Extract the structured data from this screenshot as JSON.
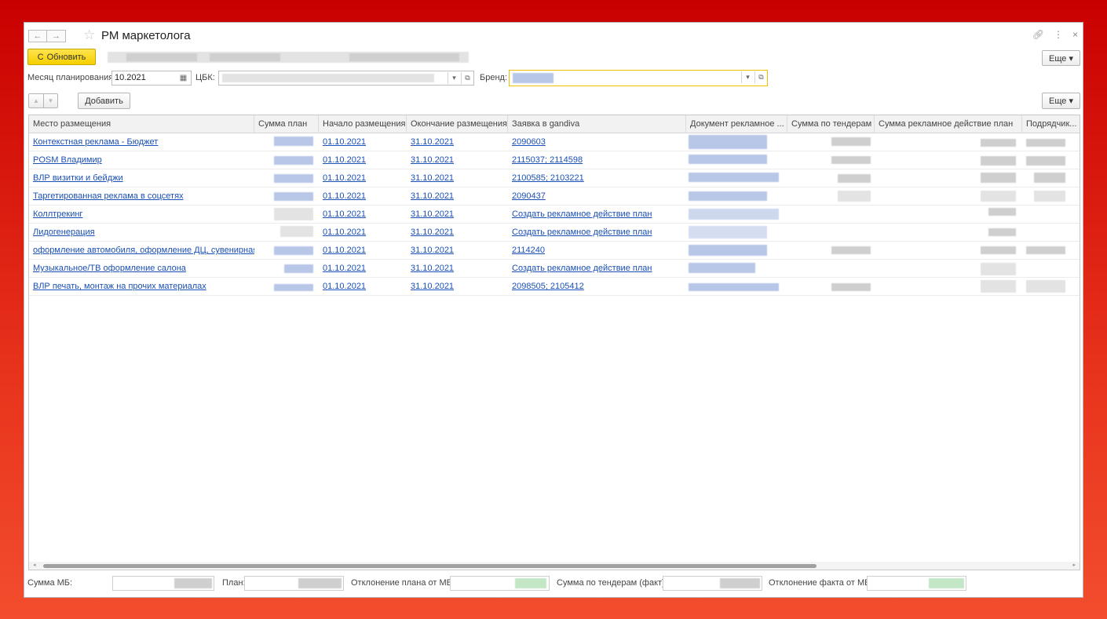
{
  "window": {
    "title": "РМ маркетолога",
    "nav_back": "←",
    "nav_forward": "→",
    "star": "☆",
    "link_icon": "🔗",
    "menu_icon": "⋮",
    "close_icon": "×"
  },
  "toolbar": {
    "refresh_label": "Обновить",
    "refresh_icon": "C",
    "more_label": "Еще ▾"
  },
  "filters": {
    "month_label": "Месяц планирования:",
    "month_value": "10.2021",
    "calendar_icon": "▦",
    "cbk_label": "ЦБК:",
    "brand_label": "Бренд:",
    "dropdown_glyph": "▾",
    "open_glyph": "⧉"
  },
  "table_toolbar": {
    "up": "▲",
    "down": "▼",
    "add_label": "Добавить",
    "more_label": "Еще ▾"
  },
  "table": {
    "headers": [
      "Место размещения",
      "Сумма план",
      "Начало размещения",
      "Окончание размещения",
      "Заявка в gandiva",
      "Документ рекламное ...",
      "Сумма по тендерам",
      "Сумма рекламное действие план",
      "Подрядчик..."
    ],
    "rows": [
      {
        "place": "Контекстная реклама - Бюджет",
        "start": "01.10.2021",
        "end": "31.10.2021",
        "gandiva": "2090603"
      },
      {
        "place": "POSM Владимир",
        "start": "01.10.2021",
        "end": "31.10.2021",
        "gandiva": "2115037; 2114598"
      },
      {
        "place": "ВЛР визитки и бейджи",
        "start": "01.10.2021",
        "end": "31.10.2021",
        "gandiva": "2100585; 2103221"
      },
      {
        "place": "Таргетированная реклама в соцсетях",
        "start": "01.10.2021",
        "end": "31.10.2021",
        "gandiva": "2090437"
      },
      {
        "place": "Коллтрекинг",
        "start": "01.10.2021",
        "end": "31.10.2021",
        "gandiva": "Создать рекламное действие план"
      },
      {
        "place": "Лидогенерация",
        "start": "01.10.2021",
        "end": "31.10.2021",
        "gandiva": "Создать рекламное действие план"
      },
      {
        "place": "оформление автомобиля, оформление ДЦ, сувенирная...",
        "start": "01.10.2021",
        "end": "31.10.2021",
        "gandiva": "2114240"
      },
      {
        "place": "Музыкальное/ТВ оформление салона",
        "start": "01.10.2021",
        "end": "31.10.2021",
        "gandiva": "Создать рекламное действие план"
      },
      {
        "place": "ВЛР печать, монтаж на прочих материалах",
        "start": "01.10.2021",
        "end": "31.10.2021",
        "gandiva": "2098505; 2105412"
      }
    ]
  },
  "scroll": {
    "left": "◂",
    "right": "▸"
  },
  "footer": {
    "sum_mb_label": "Сумма МБ:",
    "plan_label": "План:",
    "plan_deviation_label": "Отклонение плана от МБ:",
    "tender_sum_label": "Сумма по тендерам (факт):",
    "fact_deviation_label": "Отклонение факта от МБ:"
  }
}
